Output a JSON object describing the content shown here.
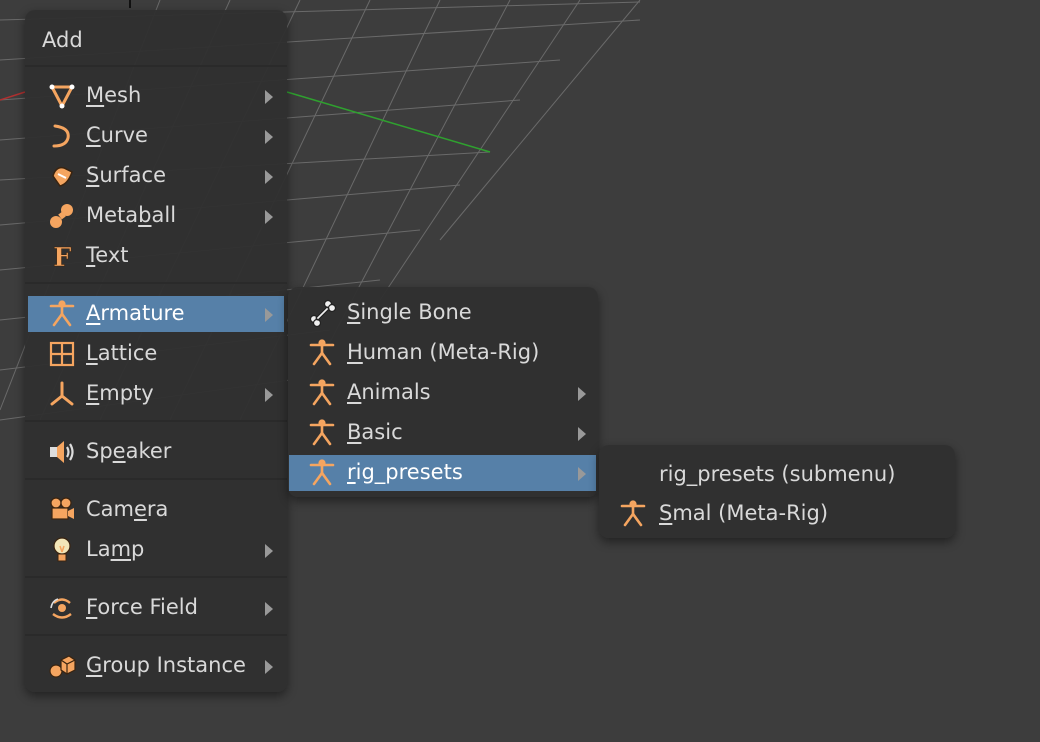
{
  "menu": {
    "title": "Add",
    "items": [
      {
        "pre": "",
        "u": "M",
        "post": "esh",
        "icon": "mesh-icon",
        "submenu": true
      },
      {
        "pre": "",
        "u": "C",
        "post": "urve",
        "icon": "curve-icon",
        "submenu": true
      },
      {
        "pre": "",
        "u": "S",
        "post": "urface",
        "icon": "surface-icon",
        "submenu": true
      },
      {
        "pre": "Meta",
        "u": "b",
        "post": "all",
        "icon": "metaball-icon",
        "submenu": true
      },
      {
        "pre": "",
        "u": "T",
        "post": "ext",
        "icon": "text-icon",
        "submenu": false
      },
      {
        "pre": "",
        "u": "A",
        "post": "rmature",
        "icon": "armature-icon",
        "submenu": true,
        "active": true
      },
      {
        "pre": "",
        "u": "L",
        "post": "attice",
        "icon": "lattice-icon",
        "submenu": false
      },
      {
        "pre": "",
        "u": "E",
        "post": "mpty",
        "icon": "empty-icon",
        "submenu": true
      },
      {
        "pre": "Sp",
        "u": "e",
        "post": "aker",
        "icon": "speaker-icon",
        "submenu": false
      },
      {
        "pre": "Cam",
        "u": "e",
        "post": "ra",
        "icon": "camera-icon",
        "submenu": false
      },
      {
        "pre": "La",
        "u": "m",
        "post": "p",
        "icon": "lamp-icon",
        "submenu": true
      },
      {
        "pre": "",
        "u": "F",
        "post": "orce Field",
        "icon": "force-field-icon",
        "submenu": true
      },
      {
        "pre": "",
        "u": "G",
        "post": "roup Instance",
        "icon": "group-instance-icon",
        "submenu": true
      }
    ]
  },
  "armature_menu": {
    "items": [
      {
        "pre": "",
        "u": "S",
        "post": "ingle Bone",
        "icon": "bone-icon",
        "submenu": false
      },
      {
        "pre": "",
        "u": "H",
        "post": "uman (Meta-Rig)",
        "icon": "armature-icon",
        "submenu": false
      },
      {
        "pre": "",
        "u": "A",
        "post": "nimals",
        "icon": "armature-icon",
        "submenu": true
      },
      {
        "pre": "",
        "u": "B",
        "post": "asic",
        "icon": "armature-icon",
        "submenu": true
      },
      {
        "pre": "",
        "u": "r",
        "post": "ig_presets",
        "icon": "armature-icon",
        "submenu": true,
        "active": true
      }
    ]
  },
  "rig_presets_menu": {
    "title": "rig_presets (submenu)",
    "items": [
      {
        "pre": "",
        "u": "S",
        "post": "mal (Meta-Rig)",
        "icon": "armature-icon",
        "submenu": false
      }
    ]
  },
  "colors": {
    "menu_bg": "#303030",
    "highlight": "#5680a8",
    "icon_orange": "#f5a560",
    "text": "#d9d9d9"
  }
}
